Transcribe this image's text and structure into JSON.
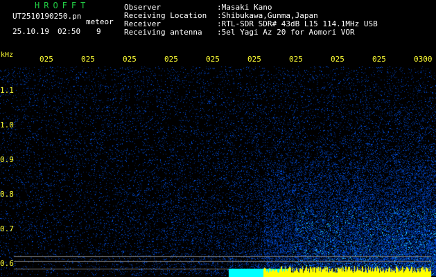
{
  "app": {
    "title": "HROFFT",
    "filename": "UT2510190250.pn",
    "mode_label": "meteor",
    "date": "25.10.19",
    "time": "02:50",
    "count": "9"
  },
  "info": {
    "observer_label": "Observer",
    "observer_value": ":Masaki Kano",
    "location_label": "Receiving Location",
    "location_value": ":Shibukawa,Gunma,Japan",
    "receiver_label": "Receiver",
    "receiver_value": ":RTL-SDR SDR# 43dB L15 114.1MHz USB",
    "antenna_label": "Receiving antenna",
    "antenna_value": ":5el Yagi Az 20 for Aomori VOR"
  },
  "axes": {
    "y_unit": "kHz",
    "x_ticks": [
      "025",
      "025",
      "025",
      "025",
      "025",
      "025",
      "025",
      "025",
      "025",
      "0300"
    ],
    "y_ticks": [
      "1.1",
      "1.0",
      "0.9",
      "0.8",
      "0.7",
      "0.6"
    ]
  },
  "colors": {
    "background": "#000000",
    "text": "#ffffff",
    "title": "#22cc44",
    "axis": "#ffff33",
    "signal": "#2a7fff",
    "strong": "#00ffff",
    "peak": "#ffff00"
  }
}
